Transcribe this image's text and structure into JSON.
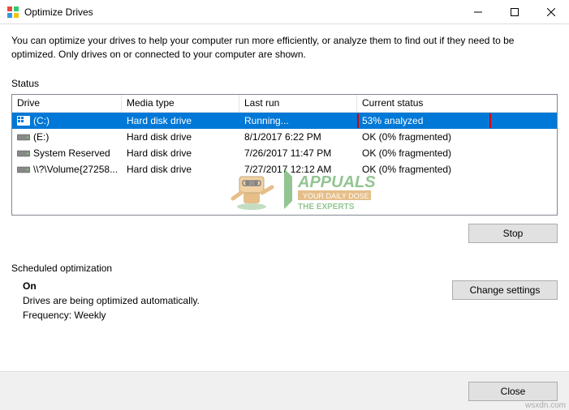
{
  "titlebar": {
    "title": "Optimize Drives"
  },
  "description": "You can optimize your drives to help your computer run more efficiently, or analyze them to find out if they need to be optimized. Only drives on or connected to your computer are shown.",
  "status_label": "Status",
  "columns": {
    "drive": "Drive",
    "media": "Media type",
    "lastrun": "Last run",
    "status": "Current status"
  },
  "drives": [
    {
      "name": "(C:)",
      "media": "Hard disk drive",
      "lastrun": "Running...",
      "status": "53% analyzed",
      "selected": true,
      "icon": "win"
    },
    {
      "name": "(E:)",
      "media": "Hard disk drive",
      "lastrun": "8/1/2017 6:22 PM",
      "status": "OK (0% fragmented)",
      "selected": false,
      "icon": "hdd"
    },
    {
      "name": "System Reserved",
      "media": "Hard disk drive",
      "lastrun": "7/26/2017 11:47 PM",
      "status": "OK (0% fragmented)",
      "selected": false,
      "icon": "hdd"
    },
    {
      "name": "\\\\?\\Volume{27258...",
      "media": "Hard disk drive",
      "lastrun": "7/27/2017 12:12 AM",
      "status": "OK (0% fragmented)",
      "selected": false,
      "icon": "hdd"
    }
  ],
  "buttons": {
    "stop": "Stop",
    "change_settings": "Change settings",
    "close": "Close"
  },
  "scheduled": {
    "label": "Scheduled optimization",
    "state": "On",
    "desc": "Drives are being optimized automatically.",
    "frequency": "Frequency: Weekly"
  },
  "watermark": {
    "brand": "APPUALS",
    "tagline": "THE EXPERTS",
    "site": "wsxdn.com"
  }
}
